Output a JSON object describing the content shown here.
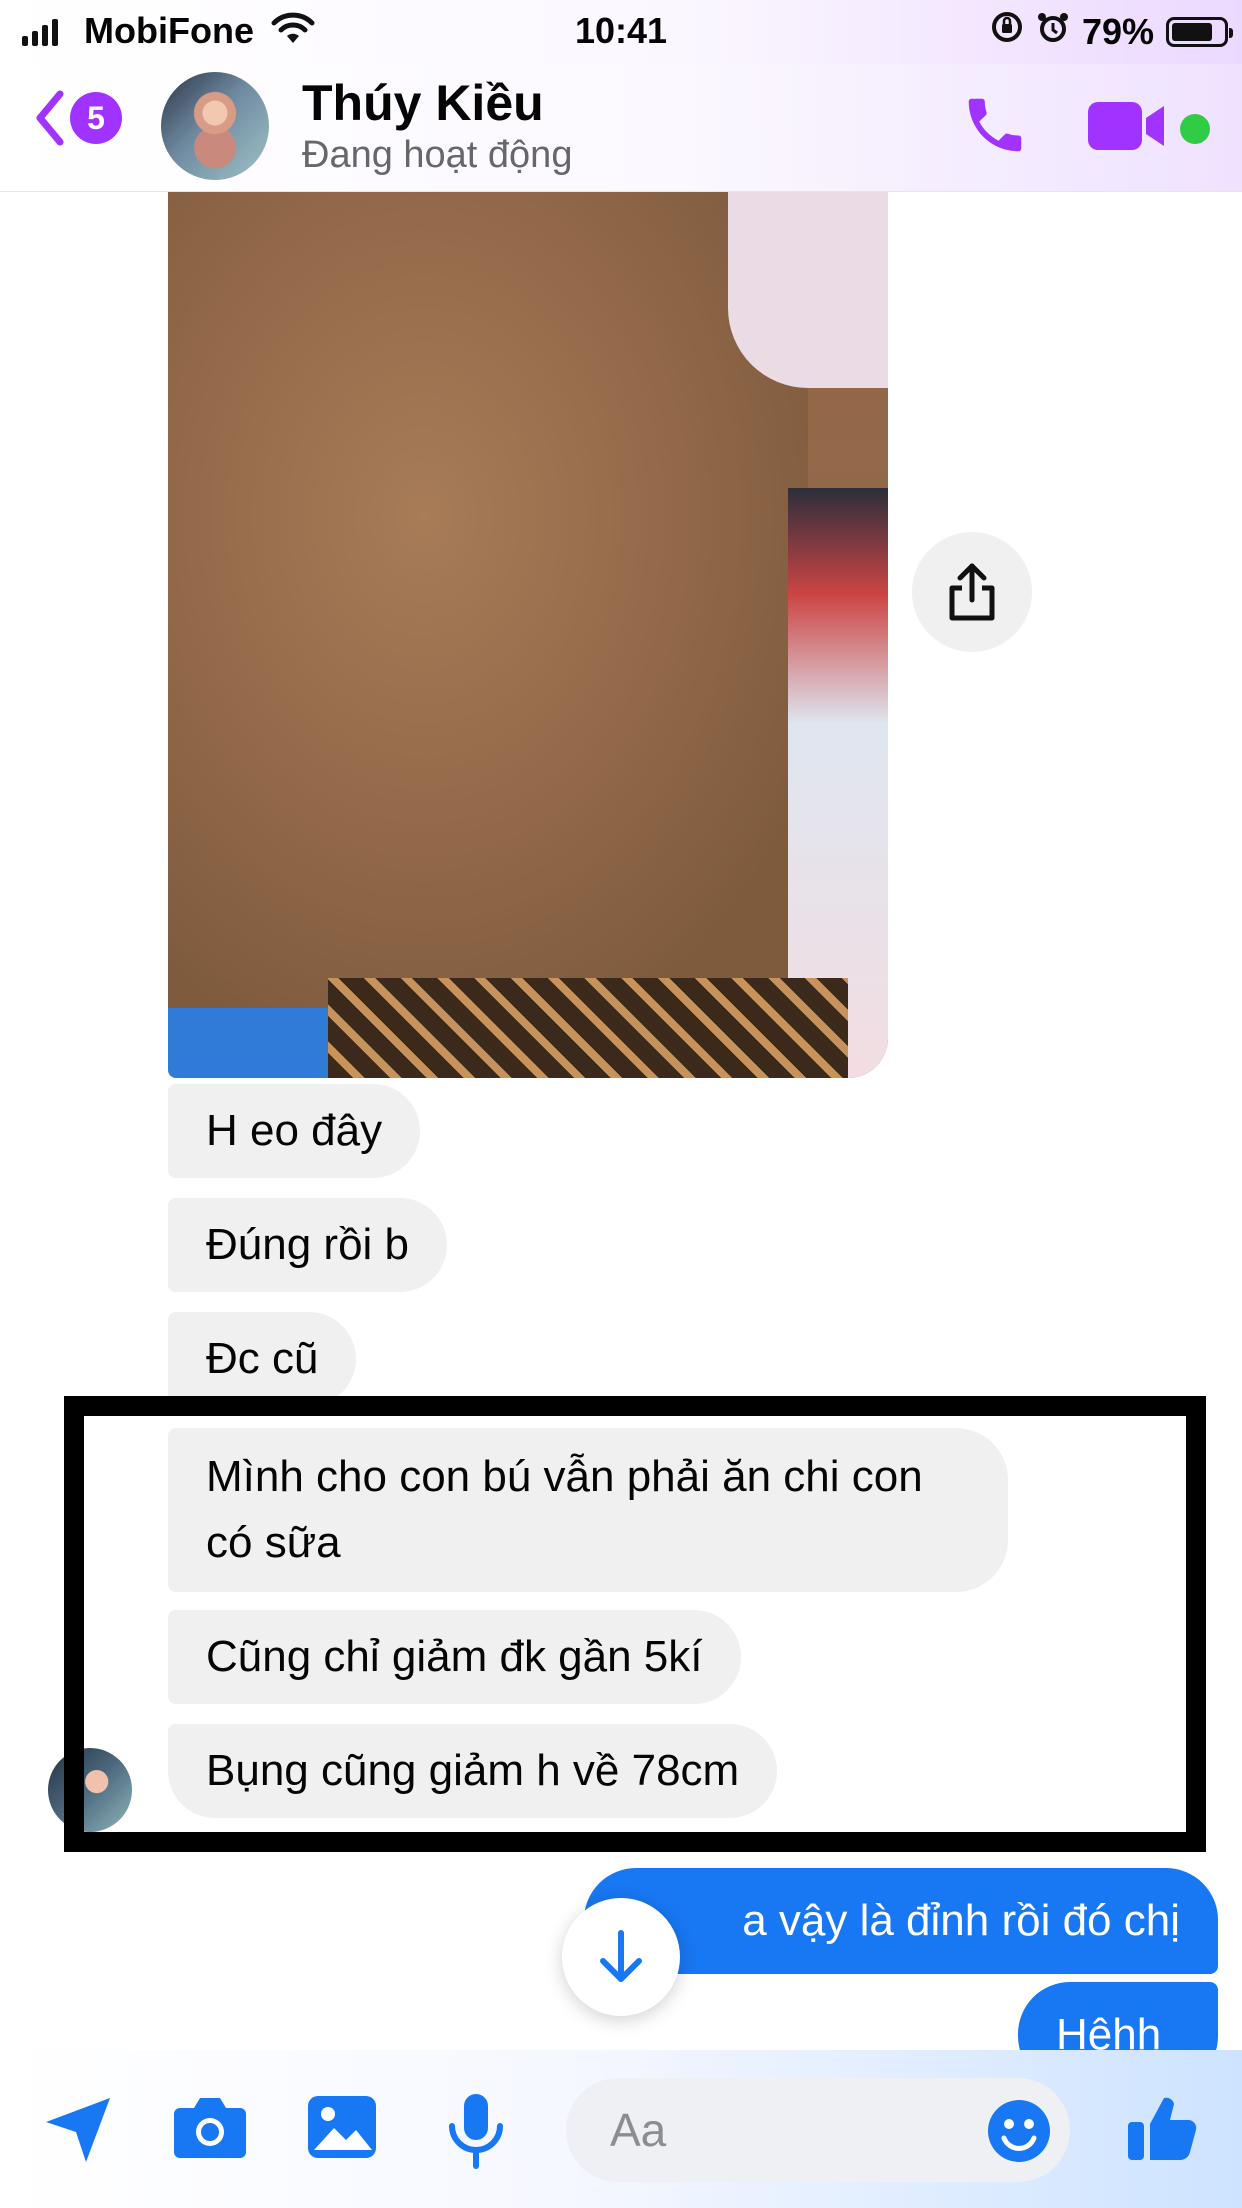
{
  "status_bar": {
    "carrier": "MobiFone",
    "time": "10:41",
    "battery_percent": "79%",
    "battery_level": 0.79,
    "icons": [
      "signal-icon",
      "wifi-icon",
      "orientation-lock-icon",
      "alarm-icon",
      "battery-icon"
    ]
  },
  "header": {
    "back_badge": "5",
    "contact_name": "Thúy Kiều",
    "contact_status": "Đang hoạt động",
    "icons": [
      "back-chevron-icon",
      "phone-icon",
      "video-camera-icon"
    ],
    "accent_color": "#a033ff",
    "online_color": "#31cc46"
  },
  "messages": {
    "incoming": [
      "H eo đây",
      "Đúng rồi b",
      "Đc cũ",
      "Mình cho con bú vẫn phải ăn chi con có sữa",
      "Cũng chỉ giảm đk gần 5kí",
      "Bụng cũng giảm h về 78cm"
    ],
    "outgoing": [
      "a vậy là đỉnh rồi đó chị",
      "Hêhh"
    ],
    "outgoing_color": "#1877f2",
    "incoming_color": "#f0f0f0"
  },
  "composer": {
    "placeholder": "Aa",
    "icons": [
      "send-location-icon",
      "camera-icon",
      "gallery-icon",
      "microphone-icon",
      "emoji-icon",
      "thumbs-up-icon"
    ]
  }
}
